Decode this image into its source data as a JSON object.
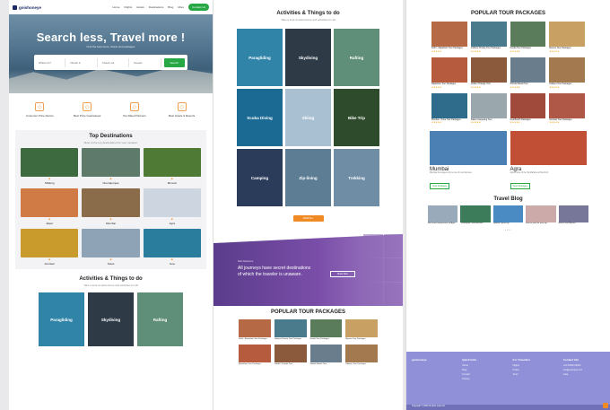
{
  "nav": {
    "brand": "goishoneye",
    "links": [
      "Home",
      "Flights",
      "Hotels",
      "Destinations",
      "Blog",
      "More"
    ],
    "cta": "Contact Us"
  },
  "hero": {
    "title": "Search less, Travel more !",
    "subtitle": "Find the best tours, hotels and packages",
    "search": {
      "field1": "Where to?",
      "field2": "Check in",
      "field3": "Check out",
      "field4": "Guests",
      "button": "Search"
    }
  },
  "features": [
    "Customer Price Alarms",
    "Best Price Guaranteed",
    "Top Rated Partners",
    "Best Hotels & Resorts"
  ],
  "destinations": {
    "title": "Top Destinations",
    "subtitle": "Most of the top destinations for your vacation",
    "items": [
      {
        "name": "Shillong",
        "color": "#3d6a3e"
      },
      {
        "name": "Cherrapunjee",
        "color": "#5d7a6b"
      },
      {
        "name": "Munnar",
        "color": "#4f7a35"
      },
      {
        "name": "Jaipur",
        "color": "#d07a45"
      },
      {
        "name": "Mumbai",
        "color": "#8a6b4a"
      },
      {
        "name": "Agra",
        "color": "#cdd6e0"
      },
      {
        "name": "Amritsar",
        "color": "#c99b2d"
      },
      {
        "name": "Kasol",
        "color": "#8ea3b6"
      },
      {
        "name": "Goa",
        "color": "#2b7d9e"
      }
    ]
  },
  "activities": {
    "title": "Activities & Things to do",
    "subtitle": "Take a look at adventures and activities for all",
    "items": [
      {
        "name": "Paragliding",
        "color": "#2f84a8"
      },
      {
        "name": "Skydiving",
        "color": "#2e3a46"
      },
      {
        "name": "Rafting",
        "color": "#5f8f79"
      },
      {
        "name": "Scuba Diving",
        "color": "#1b6a93"
      },
      {
        "name": "Skiing",
        "color": "#a9c0d3"
      },
      {
        "name": "Bike Trip",
        "color": "#2e4c2b"
      },
      {
        "name": "Camping",
        "color": "#2a3c5a"
      },
      {
        "name": "Zip-lining",
        "color": "#5d7d95"
      },
      {
        "name": "Trekking",
        "color": "#6f8da5"
      }
    ],
    "view_all": "VIEW ALL"
  },
  "banner": {
    "small": "Start Adventure",
    "text": "All journeys have secret destinations of which the traveler is unaware.",
    "button": "Book Now"
  },
  "packages": {
    "title": "POPULAR TOUR PACKAGES",
    "items": [
      {
        "title": "Delhi - Rajasthan Tour Packages",
        "color": "#b56a45"
      },
      {
        "title": "Jodhpur Private Tour Packages",
        "color": "#4a7b8c"
      },
      {
        "title": "Kerala Tour Packages",
        "color": "#5a7c5a"
      },
      {
        "title": "Mysore Tour Packages",
        "color": "#c9a064"
      },
      {
        "title": "Rajasthan Tour Packages",
        "color": "#b75b3e"
      },
      {
        "title": "Golden Triangle Tour",
        "color": "#8b5a3c"
      },
      {
        "title": "Shimla Manali Tour",
        "color": "#6a7d8d"
      },
      {
        "title": "Udaipur Tour Packages",
        "color": "#a3794f"
      },
      {
        "title": "Mumbai - Pune Tour Packages",
        "color": "#2f6b8a"
      },
      {
        "title": "Sikkim Darjeeling Tour",
        "color": "#9aa7ad"
      },
      {
        "title": "Goa Beach Packages",
        "color": "#a04a3c"
      },
      {
        "title": "Amritsar Tour Packages",
        "color": "#b05848"
      }
    ],
    "big": [
      {
        "name": "Mumbai",
        "desc": "Mumbai the largest city is one of most famous",
        "button": "View Packages",
        "color": "#4a80b3"
      },
      {
        "name": "Agra",
        "desc": "Agra, home of the Taj Mahal and Red Fort",
        "button": "View Packages",
        "color": "#c14f36"
      }
    ]
  },
  "blog": {
    "title": "Travel Blog",
    "posts": [
      {
        "title": "Best travel experiences at Agra",
        "color": "#9ab"
      },
      {
        "title": "Travelogue: Goa beaches",
        "color": "#3d7c5a"
      },
      {
        "title": "Sydney Opera trip",
        "color": "#4a8bc4"
      },
      {
        "title": "How to pack for your trip",
        "color": "#caa"
      },
      {
        "title": "How to visit Mysore",
        "color": "#779"
      }
    ],
    "dots": "• • • •"
  },
  "footer": {
    "brand": "goishoneye",
    "cols": [
      {
        "head": "Quick links",
        "items": [
          "About",
          "Blog",
          "Contact",
          "Privacy"
        ]
      },
      {
        "head": "For Travellers",
        "items": [
          "Flights",
          "Hotels",
          "Tours"
        ]
      },
      {
        "head": "Contact Info",
        "items": [
          "+91 00000 00000",
          "info@example.com",
          "India"
        ]
      }
    ],
    "copyright": "Copyright © 2020 All rights reserved"
  }
}
